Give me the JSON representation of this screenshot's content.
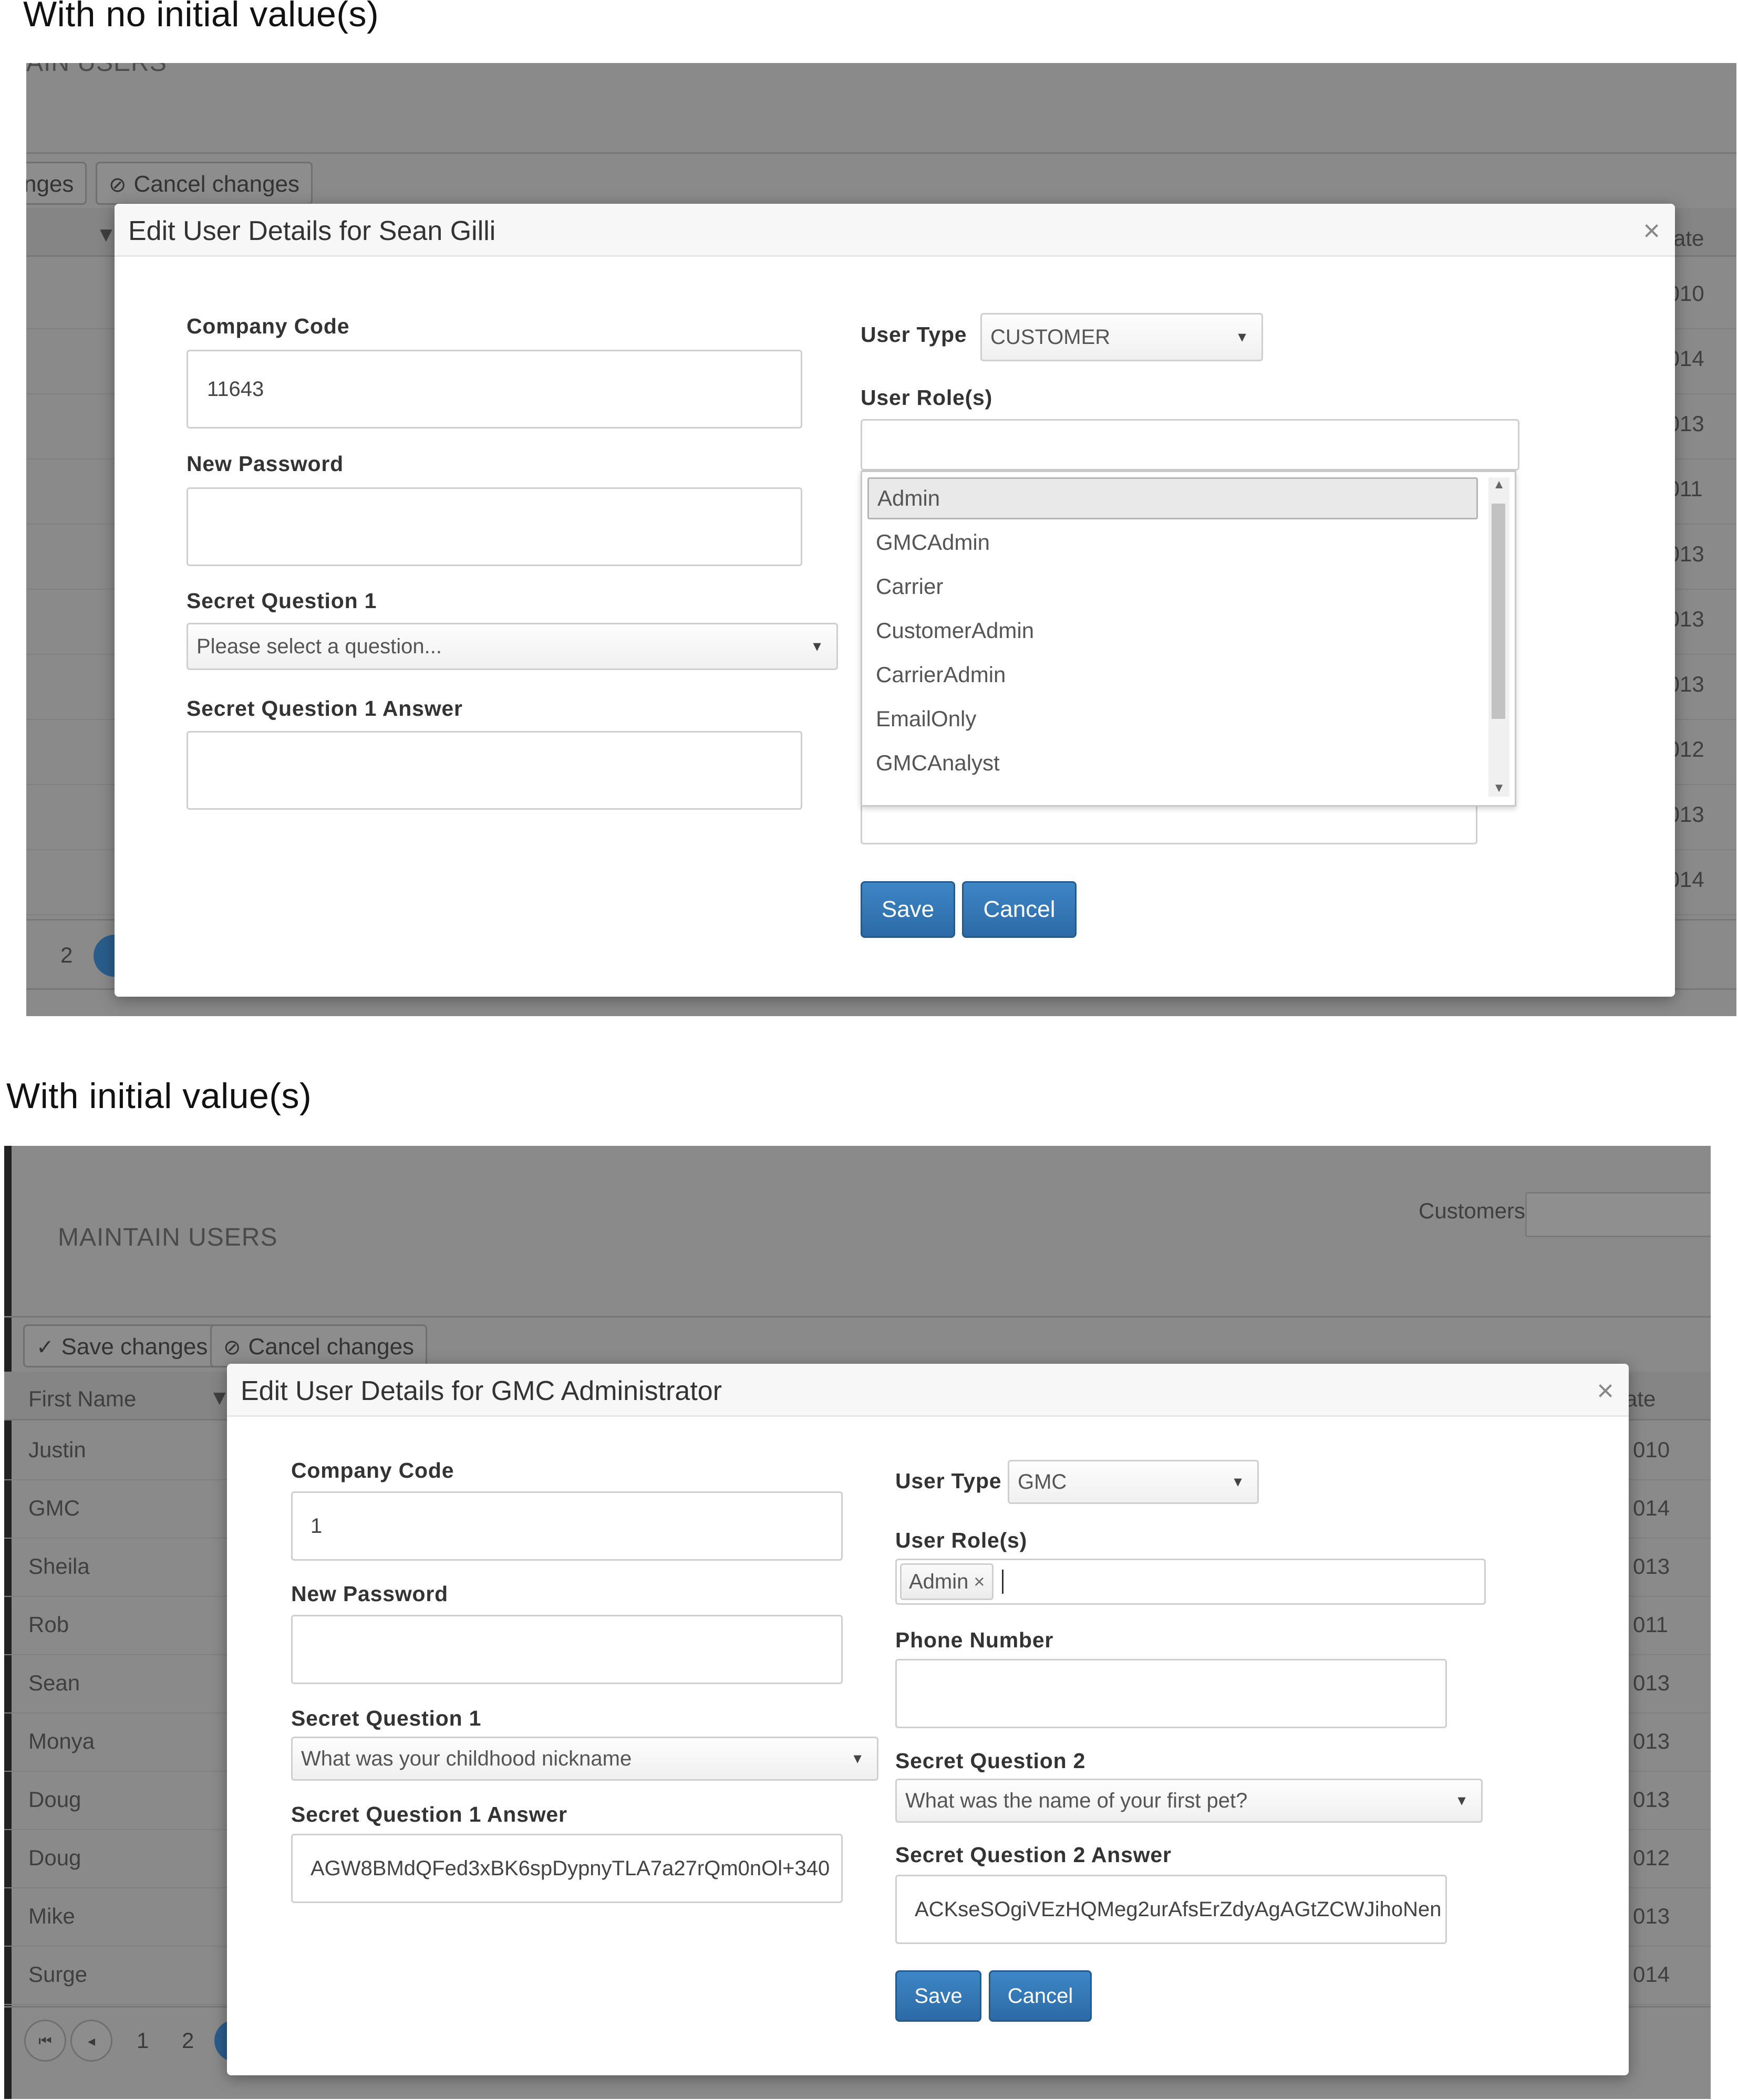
{
  "captions": {
    "no_initial": "With no initial value(s)",
    "with_initial": "With initial value(s)"
  },
  "shot1": {
    "bg": {
      "page_title_fragment": "AIN USERS",
      "save_changes_fragment": "nges",
      "cancel_changes": "Cancel changes",
      "column_fragment": "ate",
      "year_values": [
        ":010",
        ":014",
        ":013",
        ":011",
        ":013",
        ":013",
        ":013",
        ":012",
        ":013",
        ":014"
      ],
      "pager_page": "2"
    },
    "modal": {
      "title": "Edit User Details for Sean Gilli",
      "close": "×",
      "company_code_label": "Company Code",
      "company_code_value": "11643",
      "new_password_label": "New Password",
      "secret_q1_label": "Secret Question 1",
      "secret_q1_value": "Please select a question...",
      "secret_q1_answer_label": "Secret Question 1 Answer",
      "user_type_label": "User Type",
      "user_type_value": "CUSTOMER",
      "user_roles_label": "User Role(s)",
      "roles_options": [
        "Admin",
        "GMCAdmin",
        "Carrier",
        "CustomerAdmin",
        "CarrierAdmin",
        "EmailOnly",
        "GMCAnalyst"
      ],
      "save": "Save",
      "cancel": "Cancel"
    }
  },
  "shot2": {
    "bg": {
      "page_title": "MAINTAIN USERS",
      "customers_label": "Customers",
      "save_changes": "Save changes",
      "cancel_changes": "Cancel changes",
      "first_name_header": "First Name",
      "date_header_fragment": "ate",
      "first_names": [
        "Justin",
        "GMC",
        "Sheila",
        "Rob",
        "Sean",
        "Monya",
        "Doug",
        "Doug",
        "Mike",
        "Surge"
      ],
      "year_values": [
        "010",
        "014",
        "013",
        "011",
        "013",
        "013",
        "013",
        "012",
        "013",
        "014"
      ],
      "pager_first": "⏮",
      "pager_prev": "◂",
      "pager_pages": [
        "1",
        "2"
      ]
    },
    "modal": {
      "title": "Edit User Details for GMC Administrator",
      "close": "×",
      "company_code_label": "Company Code",
      "company_code_value": "1",
      "new_password_label": "New Password",
      "secret_q1_label": "Secret Question 1",
      "secret_q1_value": "What was your childhood nickname",
      "secret_q1_answer_label": "Secret Question 1 Answer",
      "secret_q1_answer_value": "AGW8BMdQFed3xBK6spDypnyTLA7a27rQm0nOl+340",
      "user_type_label": "User Type",
      "user_type_value": "GMC",
      "user_roles_label": "User Role(s)",
      "selected_role": "Admin",
      "tag_remove": "×",
      "phone_label": "Phone Number",
      "secret_q2_label": "Secret Question 2",
      "secret_q2_value": "What was the name of your first pet?",
      "secret_q2_answer_label": "Secret Question 2 Answer",
      "secret_q2_answer_value": "ACKseSOgiVEzHQMeg2urAfsErZdyAgAGtZCWJihoNen",
      "save": "Save",
      "cancel": "Cancel"
    }
  }
}
